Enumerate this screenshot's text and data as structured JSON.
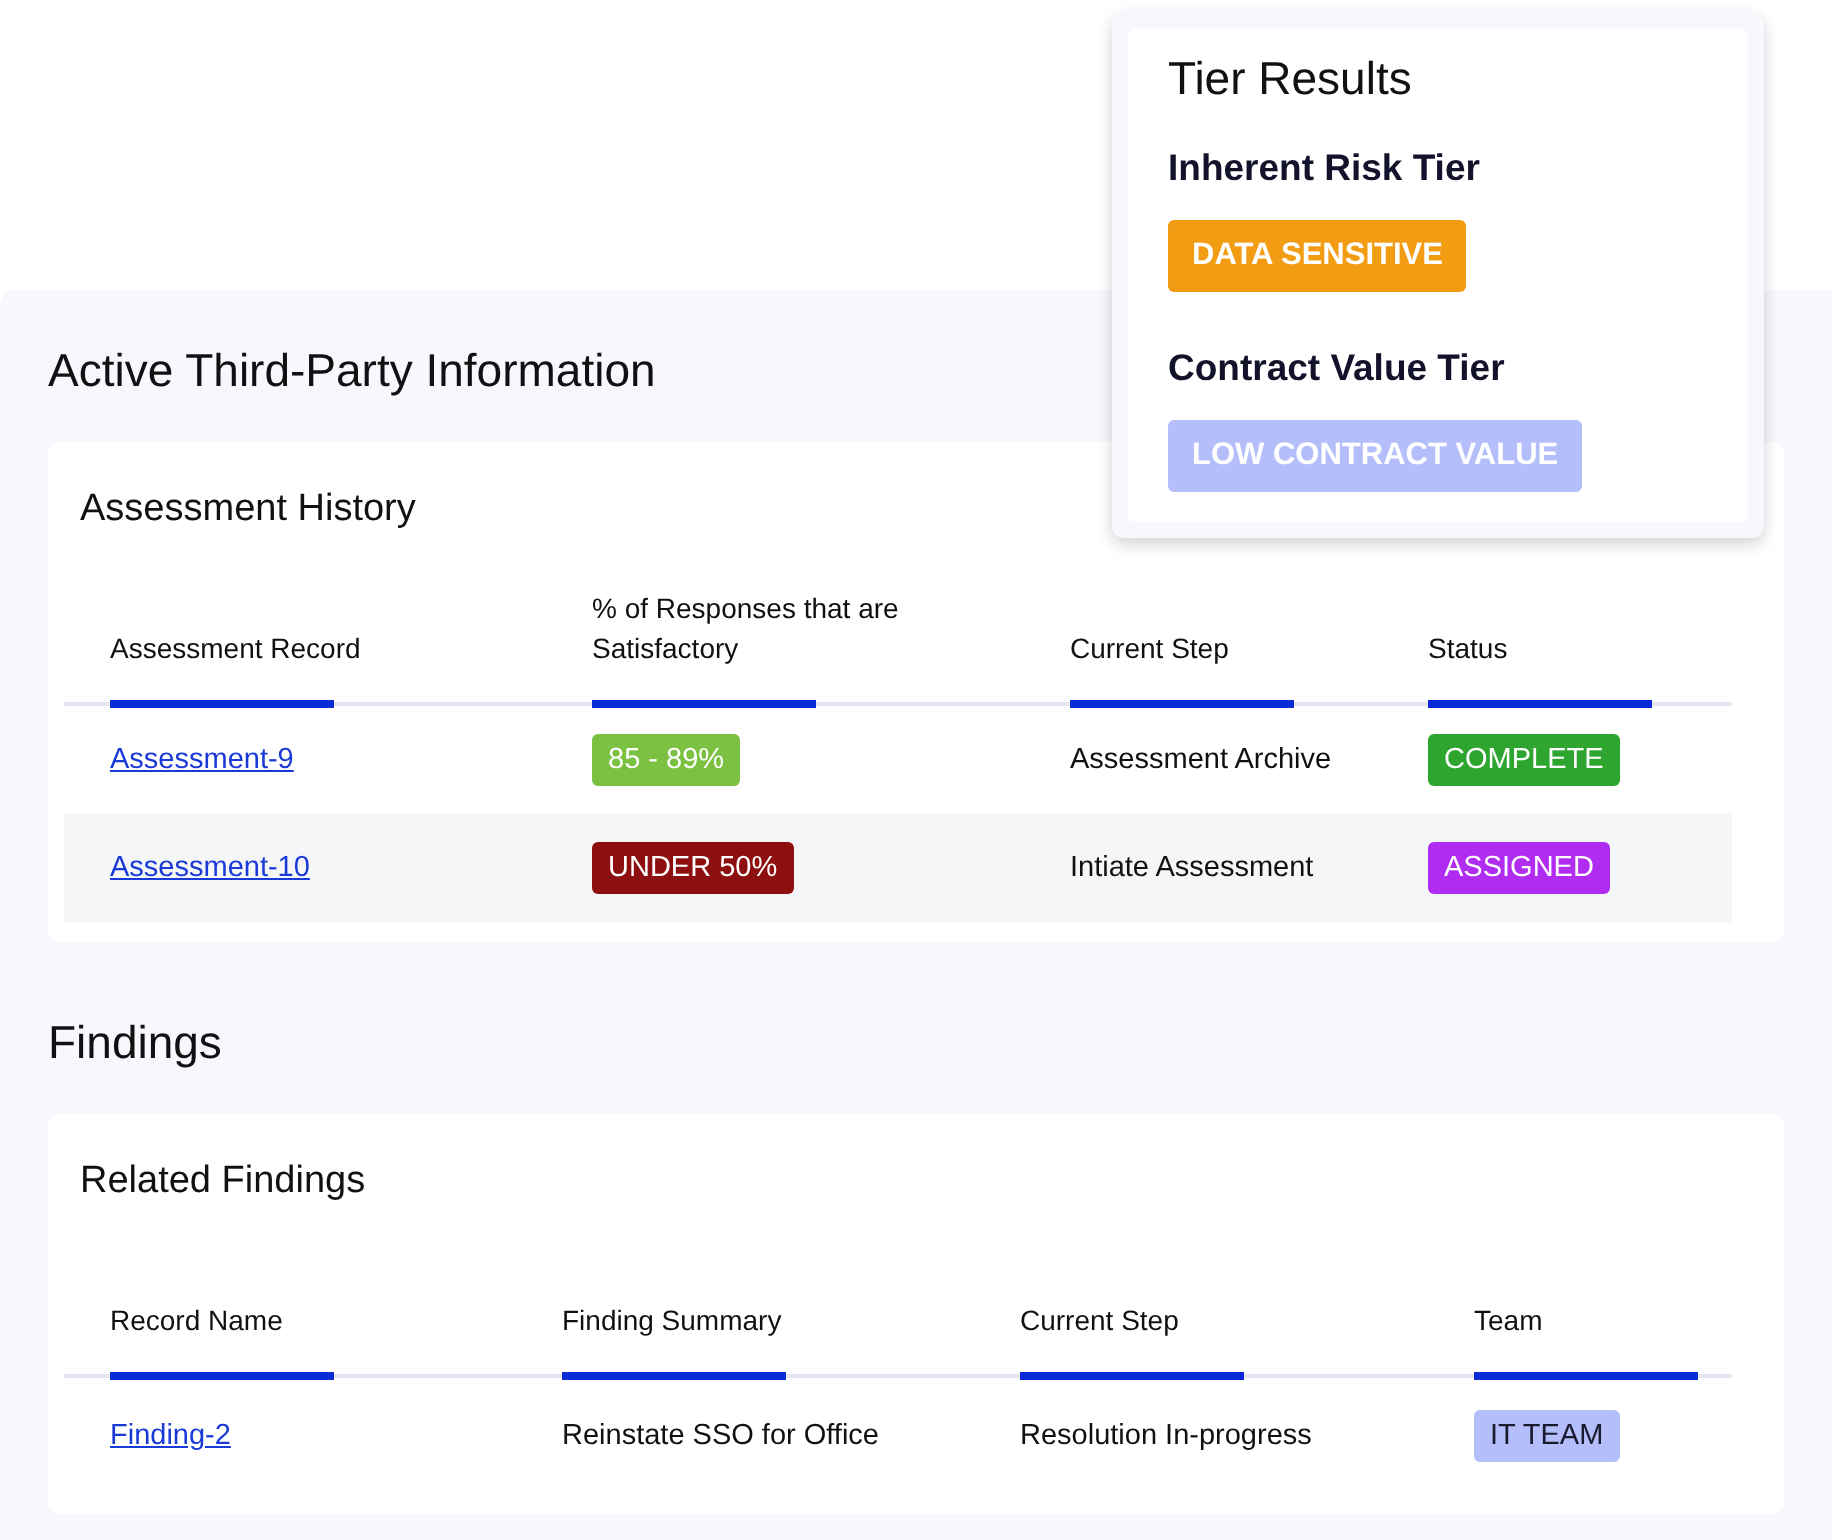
{
  "tier_results": {
    "title": "Tier Results",
    "tiers": [
      {
        "label": "Inherent Risk Tier",
        "badge": {
          "text": "DATA SENSITIVE",
          "color": "#f29c14"
        }
      },
      {
        "label": "Contract Value Tier",
        "badge": {
          "text": "LOW CONTRACT VALUE",
          "color": "#b4befa"
        }
      }
    ]
  },
  "sections": [
    {
      "heading": "Active Third-Party Information",
      "card_title": "Assessment History",
      "columns": [
        "Assessment Record",
        "% of Responses that are Satisfactory",
        "Current Step",
        "Status"
      ],
      "rows": [
        {
          "record": "Assessment-9",
          "score": {
            "text": "85 - 89%",
            "color": "#7cc142"
          },
          "step": "Assessment Archive",
          "tag": {
            "text": "COMPLETE",
            "color": "#2ea52f"
          }
        },
        {
          "record": "Assessment-10",
          "score": {
            "text": "UNDER 50%",
            "color": "#8e0f0f"
          },
          "step": "Intiate Assessment",
          "tag": {
            "text": "ASSIGNED",
            "color": "#b02cf0"
          }
        }
      ]
    },
    {
      "heading": "Findings",
      "card_title": "Related Findings",
      "columns": [
        "Record Name",
        "Finding Summary",
        "Current Step",
        "Team"
      ],
      "rows": [
        {
          "record": "Finding-2",
          "summary": "Reinstate SSO for Office",
          "step": "Resolution In-progress",
          "tag": {
            "text": "IT TEAM",
            "color": "#b4befa"
          }
        }
      ]
    }
  ]
}
